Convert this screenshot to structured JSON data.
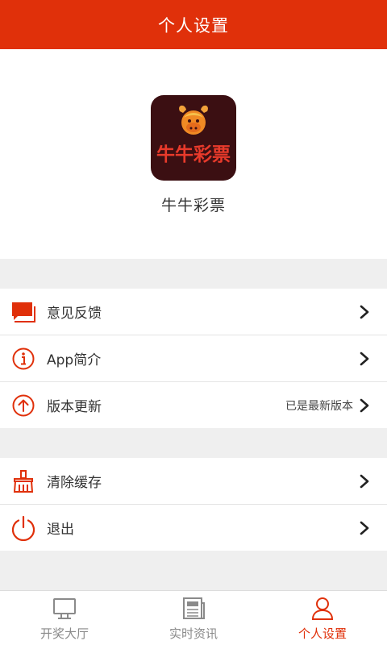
{
  "header": {
    "title": "个人设置"
  },
  "profile": {
    "logo_text": "牛牛彩票",
    "app_name": "牛牛彩票"
  },
  "menu_group_1": [
    {
      "icon": "feedback-icon",
      "label": "意见反馈",
      "extra": ""
    },
    {
      "icon": "info-icon",
      "label": "App简介",
      "extra": ""
    },
    {
      "icon": "upgrade-icon",
      "label": "版本更新",
      "extra": "已是最新版本"
    }
  ],
  "menu_group_2": [
    {
      "icon": "broom-icon",
      "label": "清除缓存",
      "extra": ""
    },
    {
      "icon": "power-icon",
      "label": "退出",
      "extra": ""
    }
  ],
  "tabbar": [
    {
      "icon": "monitor-icon",
      "label": "开奖大厅",
      "active": false
    },
    {
      "icon": "newspaper-icon",
      "label": "实时资讯",
      "active": false
    },
    {
      "icon": "user-icon",
      "label": "个人设置",
      "active": true
    }
  ],
  "colors": {
    "accent": "#e0300a",
    "logo_bg": "#3b0f12",
    "logo_text": "#e83a2b"
  }
}
